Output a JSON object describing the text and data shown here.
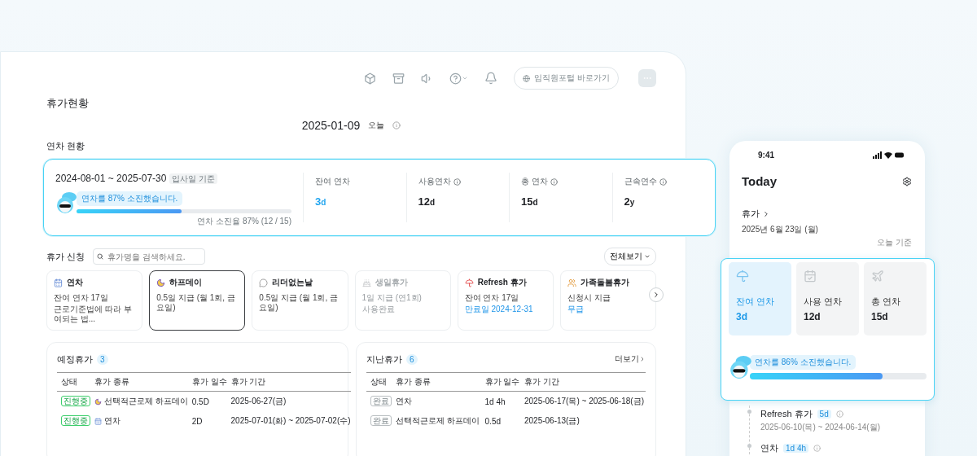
{
  "toolbar": {
    "portal_button": "임직원포털 바로가기"
  },
  "page_title": "휴가현황",
  "date": {
    "value": "2025-01-09",
    "badge": "오늘"
  },
  "annual": {
    "title": "연차 현황",
    "period": "2024-08-01 ~ 2025-07-30",
    "basis": "입사일 기준",
    "speech": "연차를 87% 소진했습니다.",
    "level": 0.49,
    "caption": "연차 소진율 87% (12 / 15)",
    "stats": [
      {
        "label": "잔여 연차",
        "value": "3",
        "unit": "d",
        "kind": "accent",
        "info": false
      },
      {
        "label": "사용연차",
        "value": "12",
        "unit": "d",
        "kind": "plain",
        "info": true
      },
      {
        "label": "총 연차",
        "value": "15",
        "unit": "d",
        "kind": "plain",
        "info": true
      },
      {
        "label": "근속연수",
        "value": "2",
        "unit": "y",
        "kind": "plain",
        "info": true
      }
    ]
  },
  "apply": {
    "title": "휴가 신청",
    "search_placeholder": "휴가명을 검색하세요.",
    "view_all": "전체보기",
    "cards": [
      {
        "name": "연차",
        "selected": false,
        "disabled": false,
        "lines": [
          {
            "text": "잔여 연차 17일",
            "kind": "plain"
          },
          {
            "text": "근로기준법에 따라 부여되는 법...",
            "kind": "plain"
          }
        ]
      },
      {
        "name": "하프데이",
        "selected": true,
        "disabled": false,
        "lines": [
          {
            "text": "0.5일 지급 (월 1회, 금요일)",
            "kind": "plain"
          }
        ]
      },
      {
        "name": "리더없는날",
        "selected": false,
        "disabled": false,
        "lines": [
          {
            "text": "0.5일 지급 (월 1회, 금요일)",
            "kind": "plain"
          }
        ]
      },
      {
        "name": "생일휴가",
        "selected": false,
        "disabled": true,
        "lines": [
          {
            "text": "1일 지급 (연1회)",
            "kind": "plain"
          },
          {
            "text": "사용완료",
            "kind": "plain"
          }
        ]
      },
      {
        "name": "Refresh 휴가",
        "selected": false,
        "disabled": false,
        "lines": [
          {
            "text": "잔여 연차 17일",
            "kind": "plain"
          },
          {
            "text": "만료일 2024-12-31",
            "kind": "link"
          }
        ]
      },
      {
        "name": "가족돌봄휴가",
        "selected": false,
        "disabled": false,
        "lines": [
          {
            "text": "신청시 지급",
            "kind": "plain"
          },
          {
            "text": "무급",
            "kind": "link"
          }
        ]
      }
    ]
  },
  "upcoming": {
    "title": "예정휴가",
    "count": "3",
    "columns": [
      "상태",
      "휴가 종류",
      "휴가 일수",
      "휴가 기간"
    ],
    "rows": [
      {
        "status": "진행중",
        "kind": "active",
        "type": "선택적근로제 하프데이",
        "days": "0.5D",
        "period": "2025-06-27(금)"
      },
      {
        "status": "진행중",
        "kind": "active",
        "type": "연차",
        "days": "2D",
        "period": "2025-07-01(화) ~ 2025-07-02(수)"
      }
    ]
  },
  "past": {
    "title": "지난휴가",
    "count": "6",
    "more": "더보기",
    "columns": [
      "상태",
      "휴가 종류",
      "휴가 일수",
      "휴가 기간"
    ],
    "rows": [
      {
        "status": "완료",
        "kind": "done",
        "type": "연차",
        "days": "1d 4h",
        "period": "2025-06-17(목) ~ 2025-06-18(금)"
      },
      {
        "status": "완료",
        "kind": "done",
        "type": "선택적근로제 하프데이",
        "days": "0.5d",
        "period": "2025-06-13(금)"
      }
    ]
  },
  "phone": {
    "time": "9:41",
    "title": "Today",
    "section": "휴가",
    "date": "2025년 6월 23일 (월)",
    "basis": "오늘 기준",
    "timeline": [
      {
        "name": "Refresh 휴가",
        "badge": "5d",
        "period": "2025-06-10(목) ~ 2024-06-14(월)"
      },
      {
        "name": "연차",
        "badge": "1d 4h"
      }
    ]
  },
  "float_card": {
    "tiles": [
      {
        "label": "잔여 연차",
        "value": "3d",
        "selected": true
      },
      {
        "label": "사용 연차",
        "value": "12d",
        "selected": false
      },
      {
        "label": "총 연차",
        "value": "15d",
        "selected": false
      }
    ],
    "speech": "연차를 86% 소진했습니다.",
    "level": 0.75
  }
}
